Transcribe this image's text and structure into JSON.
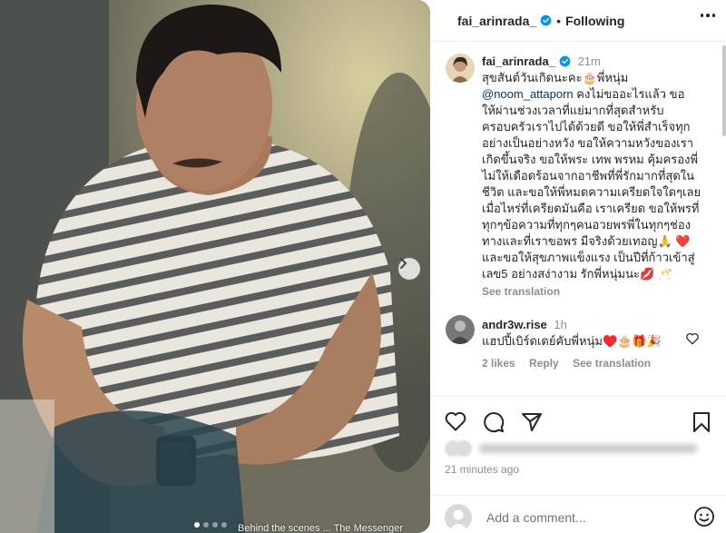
{
  "photo": {
    "overlay_caption": "Behind the scenes ... The Messenger",
    "slide_count": 4,
    "active_slide": 0,
    "next_button_icon": "chevron-right-icon"
  },
  "header": {
    "username": "fai_arinrada_",
    "separator": "•",
    "follow_status": "Following",
    "more_icon": "more-horizontal-icon"
  },
  "caption": {
    "username": "fai_arinrada_",
    "time": "21m",
    "lines": [
      "สุขสันต์วันเกิดนะคะ🎂พี่หนุ่ม",
      "@noom_attaporn",
      "ให้ผ่านช่วงเวลาที่แย่มากที่สุดสำหรับ",
      "ครอบครัวเราไปได้ด้วยดี ขอให้พี่สำเร็จทุก",
      "อย่างเป็นอย่างหวัง ขอให้ความหวังของเรา",
      "เกิดขึ้นจริง ขอให้พระ เทพ พรหม คุ้มครองพี่",
      "ไม่ให้เดือดร้อนจากอาชีพที่พี่รักมากที่สุดใน",
      "ชีวิต และขอให้พี่หมดความเครียดใจใดๆเลย",
      "เมื่อไหร่ที่เครียดมันคือ เราเครียด ขอให้พรที่",
      "ทุกๆข้อความที่ทุกๆคนอวยพรพี่ในทุกๆช่อง",
      "ทางและที่เราขอพร มีจริงด้วยเทอญ🙏 ❤️",
      "และขอให้สุขภาพแข็งแรง เป็นปีที่ก้าวเข้าสู่",
      "เลข5 อย่างสง่างาม รักพี่หนุ่มนะ💋 🥂"
    ],
    "mention_suffix": " คงไม่ขออะไรแล้ว ขอ",
    "see_translation": "See translation"
  },
  "comment": {
    "username": "andr3w.rise",
    "time": "1h",
    "text": "แฮปปี้เบิร์ดเดย์คับพี่หนุ่ม♥️🎂🎁🎉",
    "likes": "2 likes",
    "reply": "Reply",
    "see_translation": "See translation"
  },
  "actions": {
    "like_icon": "heart-icon",
    "comment_icon": "comment-icon",
    "share_icon": "share-icon",
    "save_icon": "bookmark-icon",
    "posted_ago": "21 minutes ago"
  },
  "add_comment": {
    "placeholder": "Add a comment...",
    "emoji_icon": "emoji-icon"
  },
  "colors": {
    "verified": "#0095f6",
    "text": "#262626",
    "muted": "#8e8e8e",
    "mention": "#00376b",
    "border": "#efefef"
  }
}
